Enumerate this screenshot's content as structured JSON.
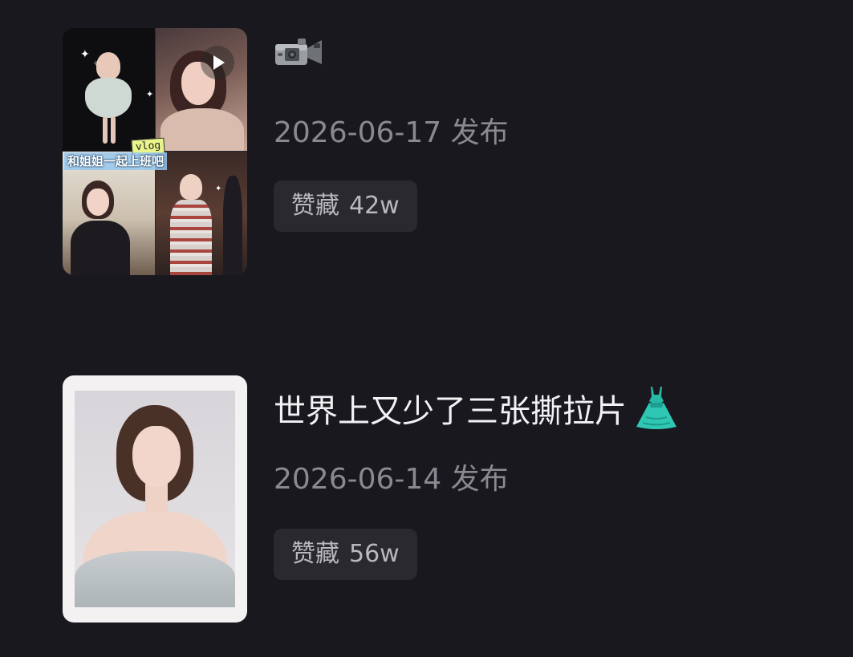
{
  "posts": [
    {
      "title": "",
      "title_icon": "video-camera-icon",
      "date": "2026-06-17 发布",
      "stat_label": "赞藏",
      "stat_value": "42w",
      "thumbnail": {
        "type": "collage",
        "tag": "vlog",
        "caption": "和姐姐一起上班吧",
        "icons": [
          "play-icon",
          "sparkle-icon"
        ]
      }
    },
    {
      "title": "世界上又少了三张撕拉片",
      "title_icon": "dress-icon",
      "date": "2026-06-14 发布",
      "stat_label": "赞藏",
      "stat_value": "56w",
      "thumbnail": {
        "type": "polaroid-portrait"
      }
    }
  ],
  "colors": {
    "background": "#19181e",
    "title": "#f2f2f4",
    "date": "#8a8990",
    "pill_bg": "#2a292f",
    "pill_text": "#b9b8be",
    "dress_accent": "#2fc7b4"
  }
}
